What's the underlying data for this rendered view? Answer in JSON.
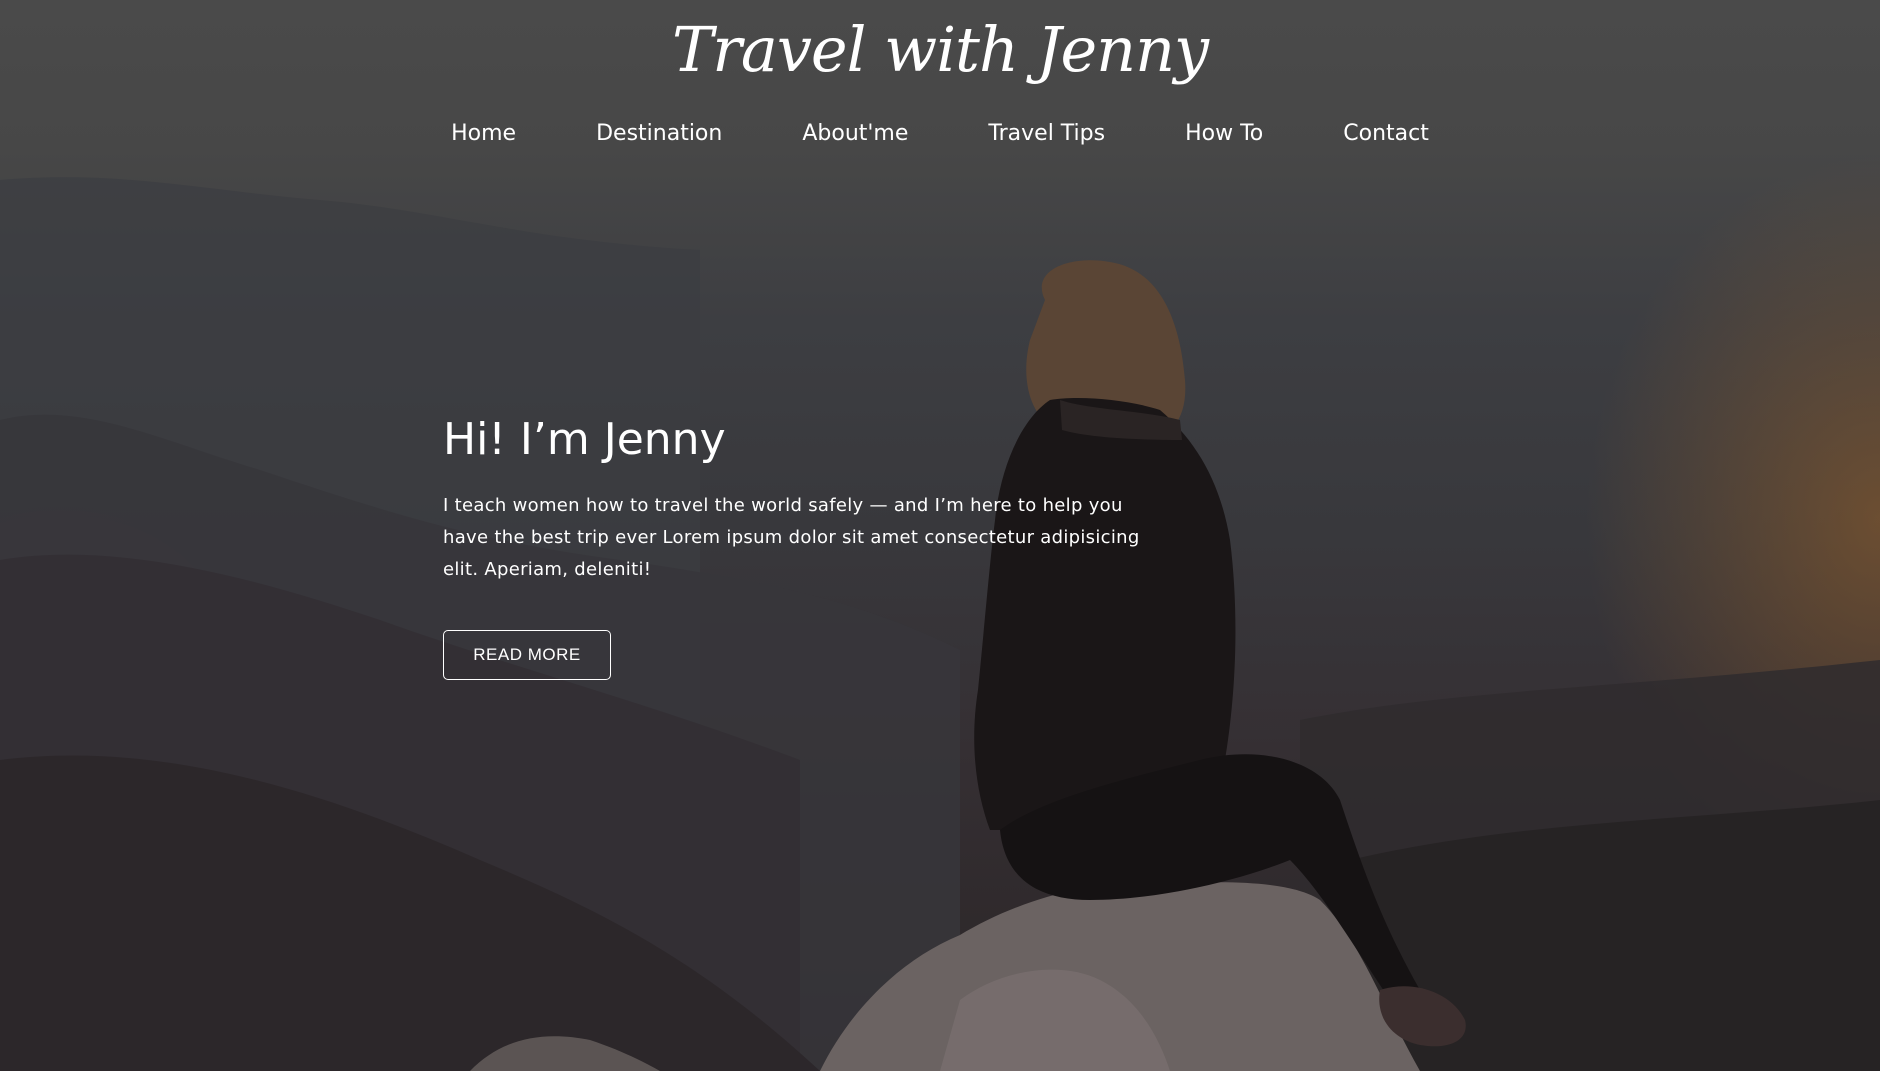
{
  "site": {
    "title": "Travel with Jenny"
  },
  "nav": {
    "items": [
      {
        "label": "Home"
      },
      {
        "label": "Destination"
      },
      {
        "label": "About'me"
      },
      {
        "label": "Travel Tips"
      },
      {
        "label": "How To"
      },
      {
        "label": "Contact"
      }
    ]
  },
  "hero": {
    "heading": "Hi! I’m Jenny",
    "text": "I teach women how to travel the world safely — and I’m here to help you have the best trip ever Lorem ipsum dolor sit amet consectetur adipisicing elit. Aperiam, deleniti!",
    "button_label": "READ MORE"
  },
  "colors": {
    "text": "#ffffff",
    "overlay": "#3e3d3d",
    "warm_glow": "#96602a"
  }
}
